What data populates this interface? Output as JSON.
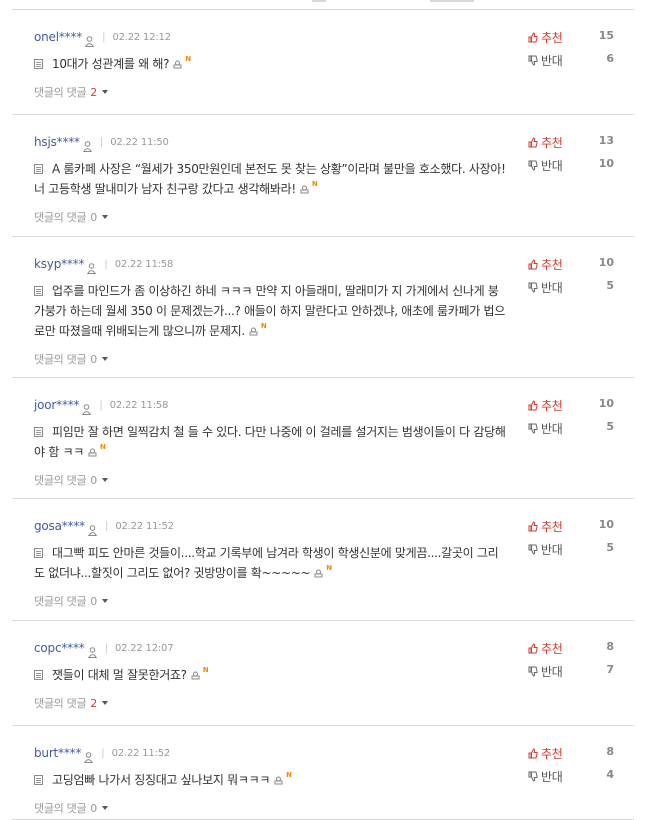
{
  "labels": {
    "recommend": "추천",
    "oppose": "반대",
    "reply_prefix": "댓글의 댓글"
  },
  "colors": {
    "author": "#435ba6",
    "recommend": "#d33a2c",
    "reply_count_active": "#e03a3a",
    "new_badge": "#f08a00"
  },
  "comments": [
    {
      "author": "onel****",
      "time": "02.22 12:12",
      "text": "10대가 성관계를 왜 해?",
      "replies": "2",
      "up": "15",
      "down": "6"
    },
    {
      "author": "hsjs****",
      "time": "02.22 11:50",
      "text": "A 룸카페 사장은 “월세가 350만원인데 본전도 못 찾는 상황”이라며 불만을 호소했다. 사장아! 너 고등학생 딸내미가 남자 친구랑 갔다고 생각해봐라!",
      "replies": "0",
      "up": "13",
      "down": "10"
    },
    {
      "author": "ksyp****",
      "time": "02.22 11:58",
      "text": "업주를 마인드가 좀 이상하긴 하네 ㅋㅋㅋ 만약 지 아들래미, 딸래미가 지 가게에서 신나게 붕가붕가 하는데 월세 350 이 문제겠는가...? 애들이 하지 말란다고 안하겠냐, 애초에 룸카페가 법으로만 따졌을때 위배되는게 많으니까 문제지.",
      "replies": "0",
      "up": "10",
      "down": "5"
    },
    {
      "author": "joor****",
      "time": "02.22 11:58",
      "text": "피임만 잘 하면 일찍감치 철 들 수 있다. 다만 나중에 이 걸레를 설거지는 범생이들이 다 감당해야 함 ㅋㅋ",
      "replies": "0",
      "up": "10",
      "down": "5"
    },
    {
      "author": "gosa****",
      "time": "02.22 11:52",
      "text": "대그빡 피도 안마른 것들이....학교 기록부에 남겨라 학생이 학생신분에 맞게끔....갈곳이 그리도 없더냐...할짓이 그리도 없어? 귓방망이를 확~~~~~",
      "replies": "0",
      "up": "10",
      "down": "5"
    },
    {
      "author": "copc****",
      "time": "02.22 12:07",
      "text": "잿들이 대체 멀 잘못한거죠?",
      "replies": "2",
      "up": "8",
      "down": "7"
    },
    {
      "author": "burt****",
      "time": "02.22 11:52",
      "text": "고딩엄빠 나가서 징징대고 싶나보지 뭐ㅋㅋㅋ",
      "replies": "0",
      "up": "8",
      "down": "4"
    }
  ]
}
